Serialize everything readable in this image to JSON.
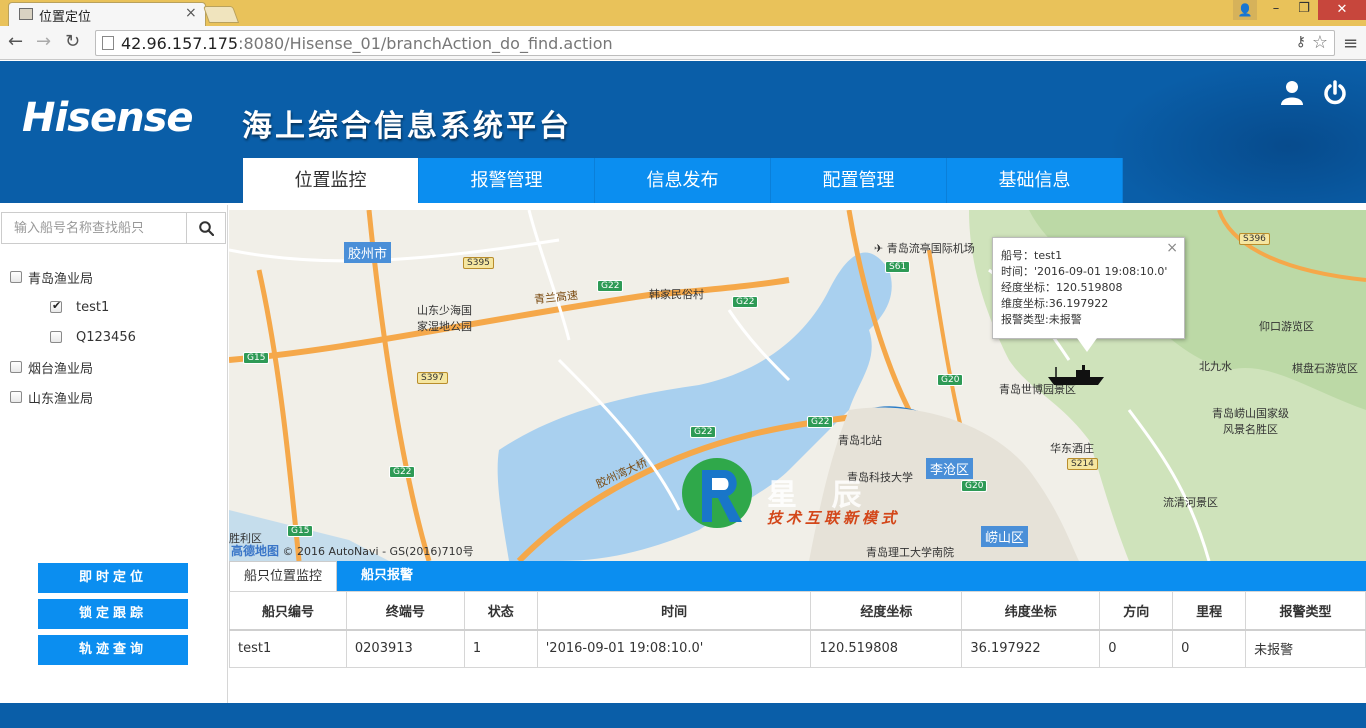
{
  "browser": {
    "tab_title": "位置定位",
    "url_host": "42.96.157.175",
    "url_rest": ":8080/Hisense_01/branchAction_do_find.action"
  },
  "header": {
    "logo": "Hisense",
    "title": "海上综合信息系统平台",
    "nav": [
      {
        "label": "位置监控",
        "active": true
      },
      {
        "label": "报警管理",
        "active": false
      },
      {
        "label": "信息发布",
        "active": false
      },
      {
        "label": "配置管理",
        "active": false
      },
      {
        "label": "基础信息",
        "active": false
      }
    ]
  },
  "sidebar": {
    "search_placeholder": "输入船号名称查找船只",
    "tree": [
      {
        "label": "青岛渔业局",
        "checked": false,
        "level": 0
      },
      {
        "label": "test1",
        "checked": true,
        "level": 1
      },
      {
        "label": "Q123456",
        "checked": false,
        "level": 1
      },
      {
        "label": "烟台渔业局",
        "checked": false,
        "level": 0
      },
      {
        "label": "山东渔业局",
        "checked": false,
        "level": 0
      }
    ],
    "buttons": [
      "即时定位",
      "锁定跟踪",
      "轨迹查询"
    ]
  },
  "map": {
    "labels": {
      "jiaozhou": "胶州市",
      "licang": "李沧区",
      "laoshan": "崂山区",
      "airport": "青岛流亭国际机场",
      "hanjia": "韩家民俗村",
      "wetland1": "山东少海国",
      "wetland2": "家湿地公园",
      "expo": "青岛世博园景区",
      "beijiu": "北九水",
      "yangkou": "仰口游览区",
      "qipan": "棋盘石游览区",
      "laoshan_park1": "青岛崂山国家级",
      "laoshan_park2": "风景名胜区",
      "huadong": "华东酒庄",
      "liuqing": "流清河景区",
      "north_station": "青岛北站",
      "qust": "青岛科技大学",
      "qtech": "青岛理工大学南院",
      "qinglan": "青兰高速",
      "jiaozhou_bridge": "胶州湾大桥",
      "shengli": "胜利区"
    },
    "roads": {
      "g22a": "G22",
      "g22b": "G22",
      "g22c": "G22",
      "g22d": "G22",
      "g22e": "G22",
      "g15a": "G15",
      "g15b": "G15",
      "g20a": "G20",
      "g20b": "G20",
      "s61": "S61",
      "s395": "S395",
      "s396": "S396",
      "s397": "S397",
      "s214": "S214"
    },
    "attribution_brand": "高德地图",
    "attribution_text": "© 2016 AutoNavi - GS(2016)710号",
    "popup": {
      "ship_no": "船号：test1",
      "time": "时间：'2016-09-01 19:08:10.0'",
      "lon": "经度坐标：120.519808",
      "lat": "维度坐标:36.197922",
      "alarm": "报警类型:未报警"
    },
    "watermark_text": "星 辰",
    "watermark_sub": "技术互联新模式"
  },
  "bottom": {
    "tabs": [
      "船只位置监控",
      "船只报警"
    ],
    "table": {
      "headers": [
        "船只编号",
        "终端号",
        "状态",
        "时间",
        "经度坐标",
        "纬度坐标",
        "方向",
        "里程",
        "报警类型"
      ],
      "rows": [
        [
          "test1",
          "0203913",
          "1",
          "'2016-09-01 19:08:10.0'",
          "120.519808",
          "36.197922",
          "0",
          "0",
          "未报警"
        ]
      ]
    }
  },
  "colors": {
    "header_blue": "#0a5ea8",
    "accent_blue": "#0b8ef0",
    "titlebar": "#e9c25a"
  }
}
